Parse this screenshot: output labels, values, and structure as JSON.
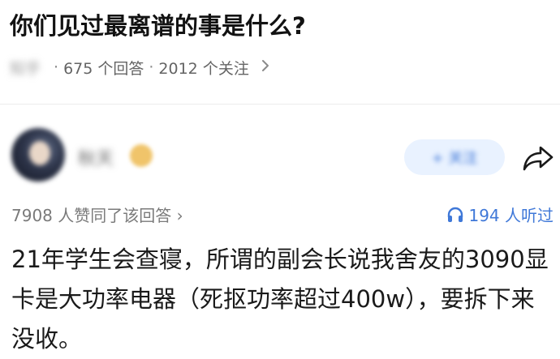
{
  "question": {
    "title": "你们见过最离谱的事是什么?",
    "source_tag": "知乎",
    "separator": "·",
    "answer_count": "675 个回答",
    "follow_count": "2012 个关注",
    "more_icon": "chevron-right-icon"
  },
  "author": {
    "name": "秋天",
    "badge_icon": "badge-icon",
    "follow_label": "+ 关注",
    "share_icon": "share-icon"
  },
  "answer_meta": {
    "agree_text": "7908 人赞同了该回答",
    "agree_chevron": "›",
    "listen_icon": "headphones-icon",
    "listen_text": "194 人听过"
  },
  "answer": {
    "body": "21年学生会查寝，所谓的副会长说我舍友的3090显卡是大功率电器（死抠功率超过400w），要拆下来没收。"
  },
  "colors": {
    "accent": "#3f78d8",
    "follow_bg": "#e9f2ff",
    "text_primary": "#1a1a1a",
    "text_secondary": "#646464",
    "divider": "#ececec"
  }
}
